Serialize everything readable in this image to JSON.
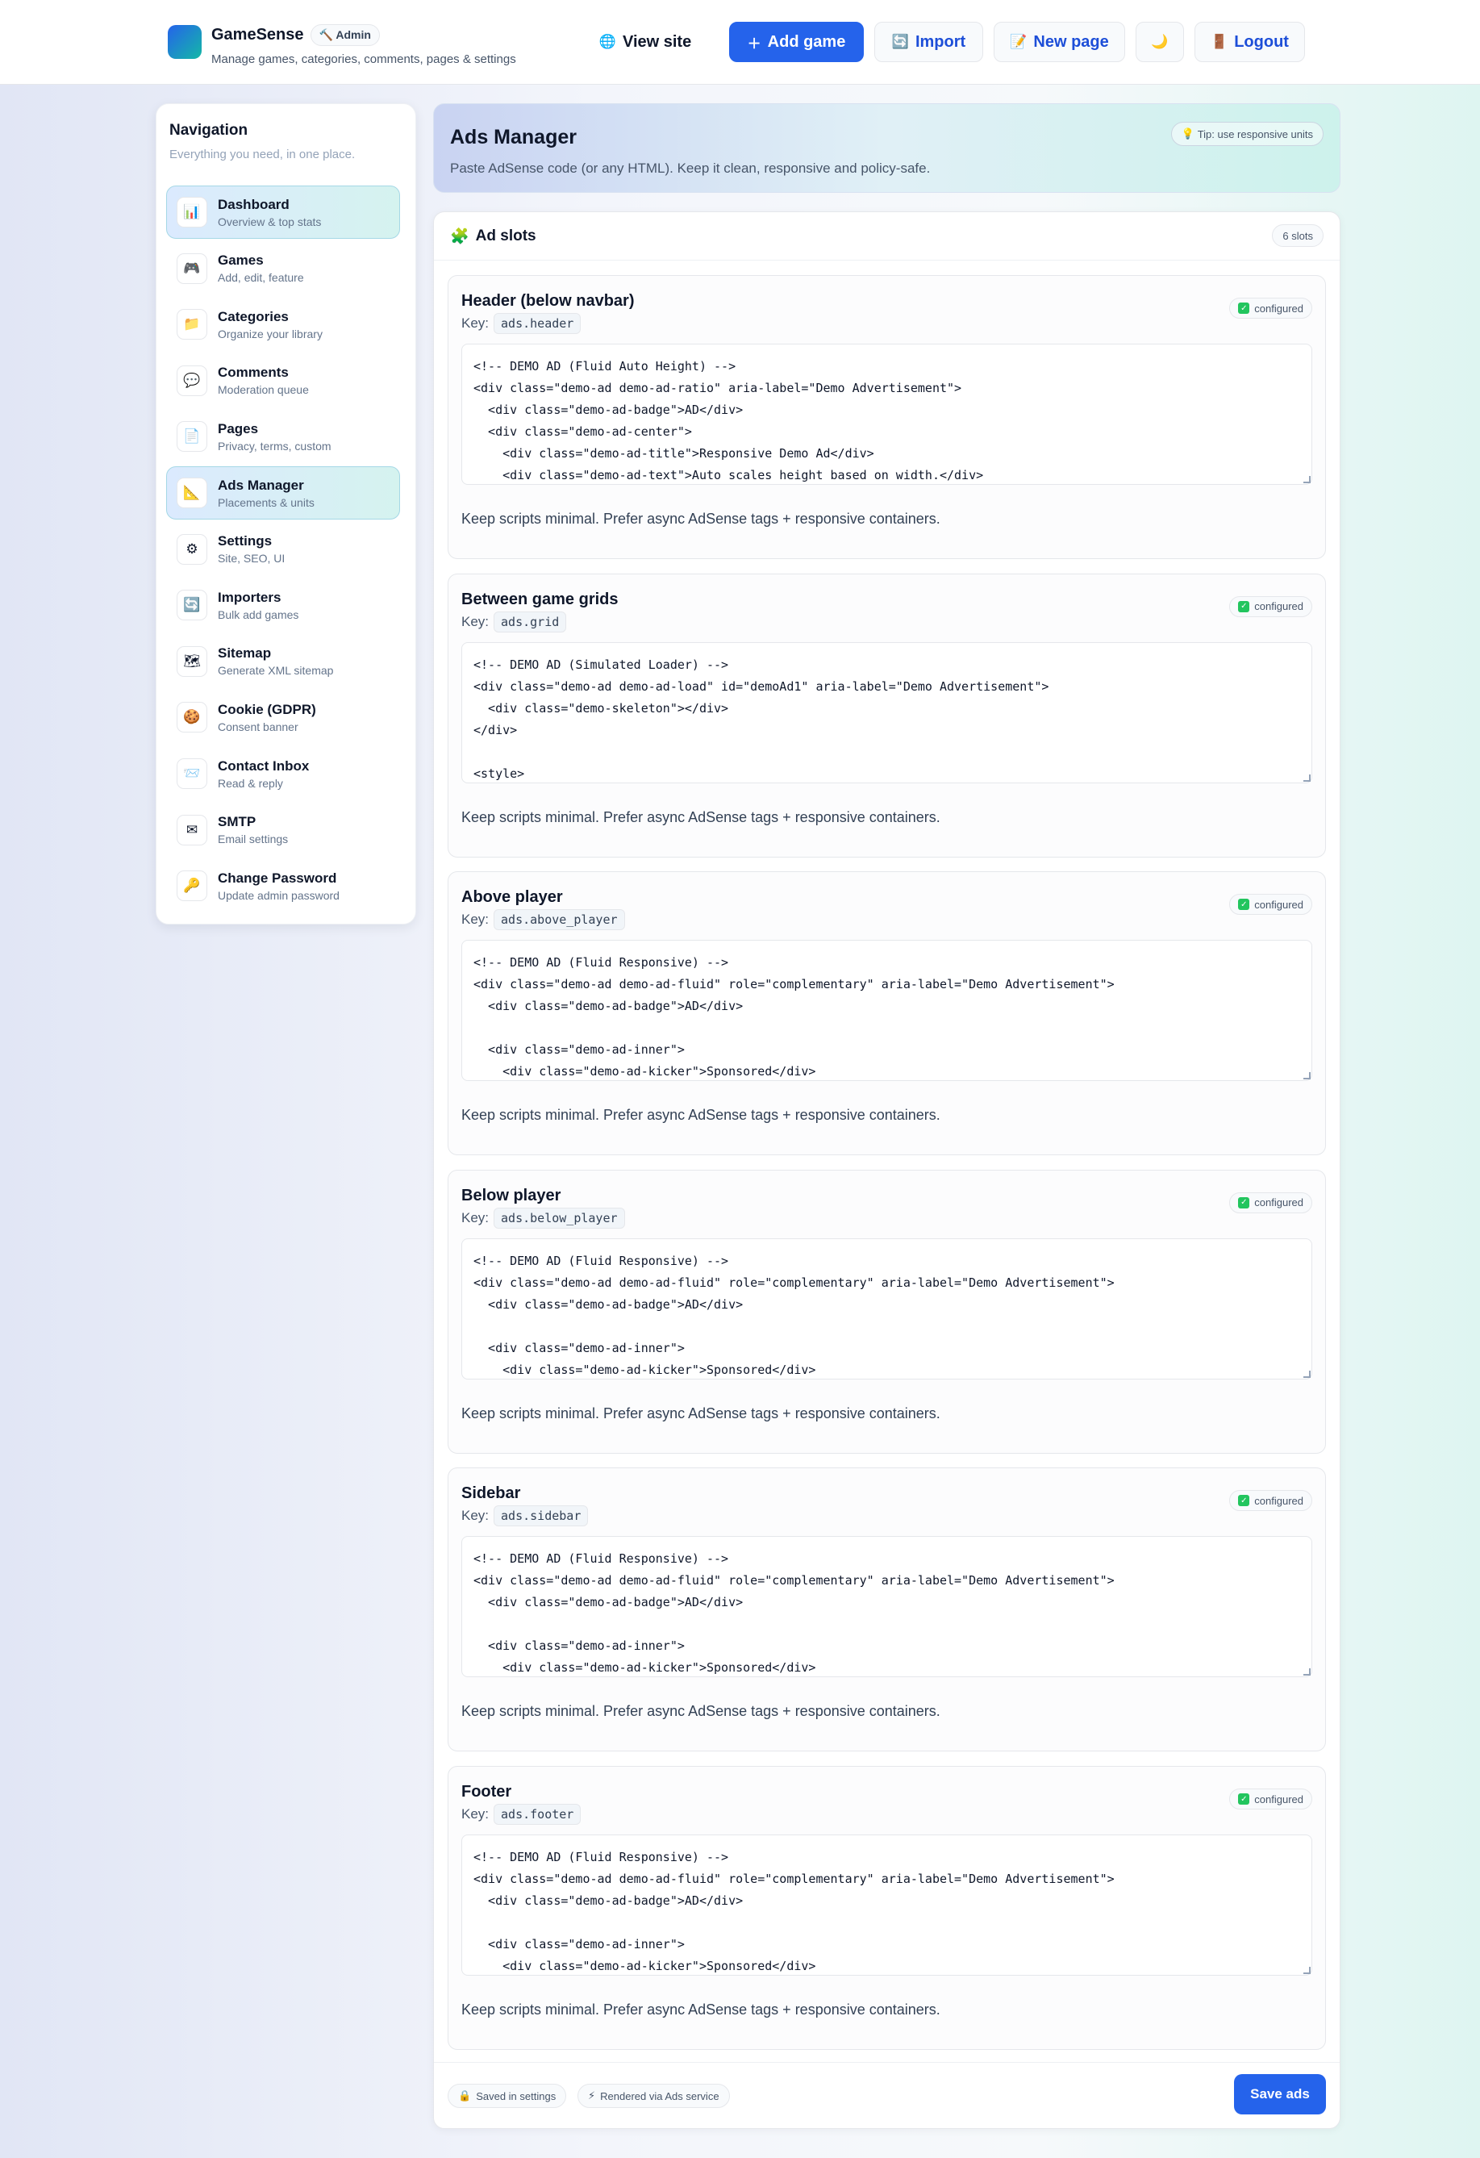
{
  "brand": {
    "name": "GameSense",
    "badge": "Admin",
    "badge_icon": "🔨",
    "subtitle": "Manage games, categories, comments, pages & settings"
  },
  "nav": {
    "view_site": {
      "label": "View site",
      "icon": "🌐"
    },
    "add_game": {
      "label": "Add game",
      "icon": "＋"
    },
    "import": {
      "label": "Import",
      "icon": "🔄"
    },
    "new_page": {
      "label": "New page",
      "icon": "📝"
    },
    "theme": {
      "icon": "🌙"
    },
    "logout": {
      "label": "Logout",
      "icon": "🚪"
    }
  },
  "sidebar": {
    "title": "Navigation",
    "subtitle": "Everything you need, in one place.",
    "items": [
      {
        "label": "Dashboard",
        "desc": "Overview & top stats",
        "icon": "📊"
      },
      {
        "label": "Games",
        "desc": "Add, edit, feature",
        "icon": "🎮"
      },
      {
        "label": "Categories",
        "desc": "Organize your library",
        "icon": "📁"
      },
      {
        "label": "Comments",
        "desc": "Moderation queue",
        "icon": "💬"
      },
      {
        "label": "Pages",
        "desc": "Privacy, terms, custom",
        "icon": "📄"
      },
      {
        "label": "Ads Manager",
        "desc": "Placements & units",
        "icon": "📐"
      },
      {
        "label": "Settings",
        "desc": "Site, SEO, UI",
        "icon": "⚙"
      },
      {
        "label": "Importers",
        "desc": "Bulk add games",
        "icon": "🔄"
      },
      {
        "label": "Sitemap",
        "desc": "Generate XML sitemap",
        "icon": "🗺"
      },
      {
        "label": "Cookie (GDPR)",
        "desc": "Consent banner",
        "icon": "🍪"
      },
      {
        "label": "Contact Inbox",
        "desc": "Read & reply",
        "icon": "📨"
      },
      {
        "label": "SMTP",
        "desc": "Email settings",
        "icon": "✉"
      },
      {
        "label": "Change Password",
        "desc": "Update admin password",
        "icon": "🔑"
      }
    ]
  },
  "hero": {
    "title": "Ads Manager",
    "subtitle": "Paste AdSense code (or any HTML). Keep it clean, responsive and policy-safe.",
    "tip": "Tip: use responsive units",
    "tip_icon": "💡"
  },
  "panel": {
    "title": "Ad slots",
    "title_icon": "🧩",
    "count": "6 slots"
  },
  "key_label": "Key:",
  "configured_label": "configured",
  "hint": "Keep scripts minimal. Prefer async AdSense tags + responsive containers.",
  "slots": [
    {
      "title": "Header (below navbar)",
      "key": "ads.header",
      "code": "<!-- DEMO AD (Fluid Auto Height) -->\n<div class=\"demo-ad demo-ad-ratio\" aria-label=\"Demo Advertisement\">\n  <div class=\"demo-ad-badge\">AD</div>\n  <div class=\"demo-ad-center\">\n    <div class=\"demo-ad-title\">Responsive Demo Ad</div>\n    <div class=\"demo-ad-text\">Auto scales height based on width.</div>"
    },
    {
      "title": "Between game grids",
      "key": "ads.grid",
      "code": "<!-- DEMO AD (Simulated Loader) -->\n<div class=\"demo-ad demo-ad-load\" id=\"demoAd1\" aria-label=\"Demo Advertisement\">\n  <div class=\"demo-skeleton\"></div>\n</div>\n\n<style>"
    },
    {
      "title": "Above player",
      "key": "ads.above_player",
      "code": "<!-- DEMO AD (Fluid Responsive) -->\n<div class=\"demo-ad demo-ad-fluid\" role=\"complementary\" aria-label=\"Demo Advertisement\">\n  <div class=\"demo-ad-badge\">AD</div>\n\n  <div class=\"demo-ad-inner\">\n    <div class=\"demo-ad-kicker\">Sponsored</div>"
    },
    {
      "title": "Below player",
      "key": "ads.below_player",
      "code": "<!-- DEMO AD (Fluid Responsive) -->\n<div class=\"demo-ad demo-ad-fluid\" role=\"complementary\" aria-label=\"Demo Advertisement\">\n  <div class=\"demo-ad-badge\">AD</div>\n\n  <div class=\"demo-ad-inner\">\n    <div class=\"demo-ad-kicker\">Sponsored</div>"
    },
    {
      "title": "Sidebar",
      "key": "ads.sidebar",
      "code": "<!-- DEMO AD (Fluid Responsive) -->\n<div class=\"demo-ad demo-ad-fluid\" role=\"complementary\" aria-label=\"Demo Advertisement\">\n  <div class=\"demo-ad-badge\">AD</div>\n\n  <div class=\"demo-ad-inner\">\n    <div class=\"demo-ad-kicker\">Sponsored</div>"
    },
    {
      "title": "Footer",
      "key": "ads.footer",
      "code": "<!-- DEMO AD (Fluid Responsive) -->\n<div class=\"demo-ad demo-ad-fluid\" role=\"complementary\" aria-label=\"Demo Advertisement\">\n  <div class=\"demo-ad-badge\">AD</div>\n\n  <div class=\"demo-ad-inner\">\n    <div class=\"demo-ad-kicker\">Sponsored</div>"
    }
  ],
  "footer": {
    "saved_chip": {
      "label": "Saved in settings",
      "icon": "🔒"
    },
    "rendered_chip": {
      "label": "Rendered via Ads service",
      "icon": "⚡"
    },
    "save_button": "Save ads"
  }
}
